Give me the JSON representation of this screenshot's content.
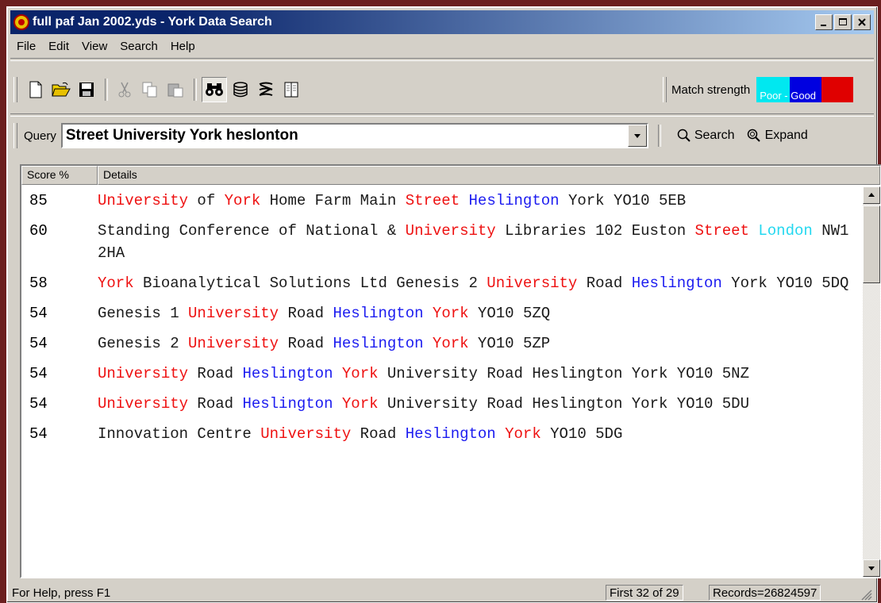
{
  "window": {
    "title": "full paf Jan 2002.yds - York Data Search",
    "controls": [
      "minimize",
      "maximize",
      "close"
    ]
  },
  "menu": [
    "File",
    "Edit",
    "View",
    "Search",
    "Help"
  ],
  "toolbar": {
    "icons": [
      "new-file-icon",
      "open-folder-icon",
      "save-icon",
      "cut-icon",
      "copy-icon",
      "paste-icon",
      "binoculars-icon",
      "database-icon",
      "sigma-icon",
      "columns-icon"
    ]
  },
  "match_strength": {
    "label": "Match strength",
    "scale_label": "Poor - Good",
    "colors": [
      "#00e8f0",
      "#0000e0",
      "#e00000"
    ]
  },
  "query": {
    "label": "Query",
    "value": "Street University York heslonton",
    "search_label": "Search",
    "expand_label": "Expand"
  },
  "results": {
    "columns": [
      "Score %",
      "Details"
    ],
    "rows": [
      {
        "score": "85",
        "parts": [
          [
            "University",
            "r"
          ],
          [
            " of ",
            ""
          ],
          [
            "York",
            "r"
          ],
          [
            " Home Farm Main ",
            ""
          ],
          [
            "Street",
            "r"
          ],
          [
            " ",
            ""
          ],
          [
            "Heslington",
            "b"
          ],
          [
            " York YO10 5EB",
            ""
          ]
        ]
      },
      {
        "score": "60",
        "parts": [
          [
            "Standing Conference of National & ",
            ""
          ],
          [
            "University",
            "r"
          ],
          [
            " Libraries 102 Euston ",
            ""
          ],
          [
            "Street",
            "r"
          ],
          [
            " ",
            ""
          ],
          [
            "London",
            "c"
          ],
          [
            " NW1 2HA",
            ""
          ]
        ]
      },
      {
        "score": "58",
        "parts": [
          [
            "York",
            "r"
          ],
          [
            " Bioanalytical Solutions Ltd Genesis 2 ",
            ""
          ],
          [
            "University",
            "r"
          ],
          [
            " Road ",
            ""
          ],
          [
            "Heslington",
            "b"
          ],
          [
            " York YO10 5DQ",
            ""
          ]
        ]
      },
      {
        "score": "54",
        "parts": [
          [
            "Genesis 1 ",
            ""
          ],
          [
            "University",
            "r"
          ],
          [
            " Road ",
            ""
          ],
          [
            "Heslington",
            "b"
          ],
          [
            " ",
            ""
          ],
          [
            "York",
            "r"
          ],
          [
            " YO10 5ZQ",
            ""
          ]
        ]
      },
      {
        "score": "54",
        "parts": [
          [
            "Genesis 2 ",
            ""
          ],
          [
            "University",
            "r"
          ],
          [
            " Road ",
            ""
          ],
          [
            "Heslington",
            "b"
          ],
          [
            " ",
            ""
          ],
          [
            "York",
            "r"
          ],
          [
            " YO10 5ZP",
            ""
          ]
        ]
      },
      {
        "score": "54",
        "parts": [
          [
            "University",
            "r"
          ],
          [
            " Road ",
            ""
          ],
          [
            "Heslington",
            "b"
          ],
          [
            " ",
            ""
          ],
          [
            "York",
            "r"
          ],
          [
            " University Road Heslington York YO10 5NZ",
            ""
          ]
        ]
      },
      {
        "score": "54",
        "parts": [
          [
            "University",
            "r"
          ],
          [
            " Road ",
            ""
          ],
          [
            "Heslington",
            "b"
          ],
          [
            " ",
            ""
          ],
          [
            "York",
            "r"
          ],
          [
            " University Road Heslington York YO10 5DU",
            ""
          ]
        ]
      },
      {
        "score": "54",
        "parts": [
          [
            "Innovation Centre ",
            ""
          ],
          [
            "University",
            "r"
          ],
          [
            " Road ",
            ""
          ],
          [
            "Heslington",
            "b"
          ],
          [
            " ",
            ""
          ],
          [
            "York",
            "r"
          ],
          [
            " YO10 5DG",
            ""
          ]
        ]
      }
    ]
  },
  "status": {
    "help": "For Help, press F1",
    "position": "First 32 of 29",
    "records": "Records=26824597"
  }
}
